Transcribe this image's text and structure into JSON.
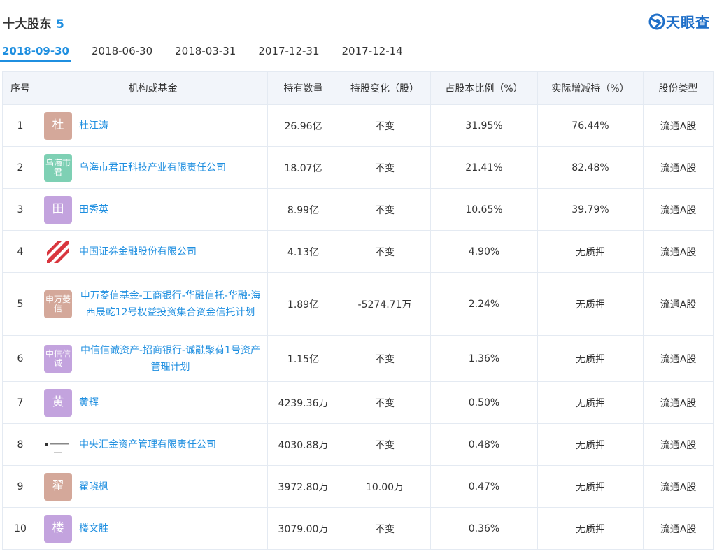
{
  "header": {
    "title": "十大股东",
    "count": "5",
    "brand_name": "天眼查",
    "brand_color": "#1f6fc8",
    "accent_color": "#1f8fe0"
  },
  "tabs": [
    {
      "label": "2018-09-30",
      "active": true
    },
    {
      "label": "2018-06-30",
      "active": false
    },
    {
      "label": "2018-03-31",
      "active": false
    },
    {
      "label": "2017-12-31",
      "active": false
    },
    {
      "label": "2017-12-14",
      "active": false
    }
  ],
  "table": {
    "columns": [
      "序号",
      "机构或基金",
      "持有数量",
      "持股变化（股）",
      "占股本比例（%）",
      "实际增减持（%）",
      "股份类型"
    ],
    "rows": [
      {
        "no": "1",
        "avatar_text": "杜",
        "avatar_color": "#d4a89a",
        "avatar_kind": "char",
        "name": "杜江涛",
        "qty": "26.96亿",
        "change": "不变",
        "ratio": "31.95%",
        "actual": "76.44%",
        "type": "流通A股"
      },
      {
        "no": "2",
        "avatar_text": "乌海市君",
        "avatar_color": "#7ed0b4",
        "avatar_kind": "small",
        "name": "乌海市君正科技产业有限责任公司",
        "qty": "18.07亿",
        "change": "不变",
        "ratio": "21.41%",
        "actual": "82.48%",
        "type": "流通A股"
      },
      {
        "no": "3",
        "avatar_text": "田",
        "avatar_color": "#c3a3de",
        "avatar_kind": "char",
        "name": "田秀英",
        "qty": "8.99亿",
        "change": "不变",
        "ratio": "10.65%",
        "actual": "39.79%",
        "type": "流通A股"
      },
      {
        "no": "4",
        "avatar_text": "",
        "avatar_color": "#d9363e",
        "avatar_kind": "logo-stripes",
        "name": "中国证券金融股份有限公司",
        "qty": "4.13亿",
        "change": "不变",
        "ratio": "4.90%",
        "actual": "无质押",
        "type": "流通A股"
      },
      {
        "no": "5",
        "avatar_text": "申万菱信",
        "avatar_color": "#d4a89a",
        "avatar_kind": "small",
        "name": "申万菱信基金-工商银行-华融信托-华融·海西晟乾12号权益投资集合资金信托计划",
        "qty": "1.89亿",
        "change": "-5274.71万",
        "ratio": "2.24%",
        "actual": "无质押",
        "type": "流通A股"
      },
      {
        "no": "6",
        "avatar_text": "中信信诚",
        "avatar_color": "#c3a3de",
        "avatar_kind": "small",
        "name": "中信信诚资产-招商银行-诚融聚荷1号资产管理计划",
        "qty": "1.15亿",
        "change": "不变",
        "ratio": "1.36%",
        "actual": "无质押",
        "type": "流通A股"
      },
      {
        "no": "7",
        "avatar_text": "黄",
        "avatar_color": "#c3a3de",
        "avatar_kind": "char",
        "name": "黄辉",
        "qty": "4239.36万",
        "change": "不变",
        "ratio": "0.50%",
        "actual": "无质押",
        "type": "流通A股"
      },
      {
        "no": "8",
        "avatar_text": "",
        "avatar_color": "#333333",
        "avatar_kind": "logo-bank",
        "name": "中央汇金资产管理有限责任公司",
        "qty": "4030.88万",
        "change": "不变",
        "ratio": "0.48%",
        "actual": "无质押",
        "type": "流通A股"
      },
      {
        "no": "9",
        "avatar_text": "翟",
        "avatar_color": "#d4a89a",
        "avatar_kind": "char",
        "name": "翟晓枫",
        "qty": "3972.80万",
        "change": "10.00万",
        "ratio": "0.47%",
        "actual": "无质押",
        "type": "流通A股"
      },
      {
        "no": "10",
        "avatar_text": "楼",
        "avatar_color": "#c3a3de",
        "avatar_kind": "char",
        "name": "楼文胜",
        "qty": "3079.00万",
        "change": "不变",
        "ratio": "0.36%",
        "actual": "无质押",
        "type": "流通A股"
      }
    ]
  }
}
